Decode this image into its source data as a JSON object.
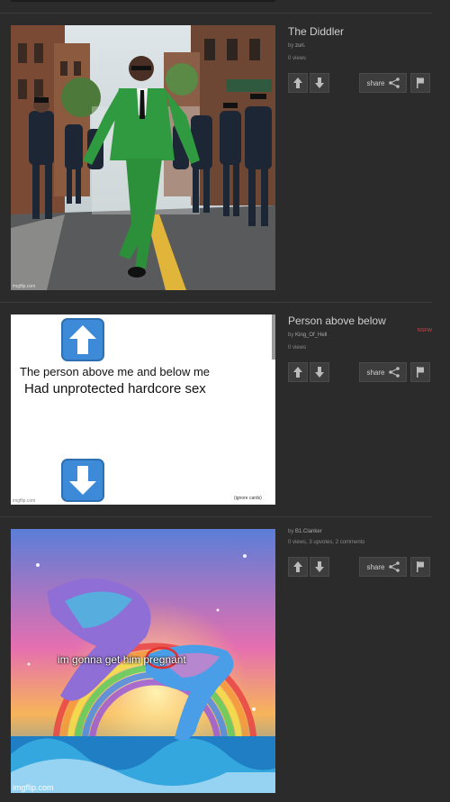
{
  "posts": [
    {
      "title": "The Diddler",
      "by_prefix": "by",
      "author": "zuri.",
      "stats": "0 views",
      "watermark": "imgflip.com"
    },
    {
      "title": "Person above below",
      "by_prefix": "by",
      "author": "King_Of_Hell",
      "stats": "0 views",
      "nsfw": "NSFW",
      "meme_line1": "The person above me and below me",
      "meme_line2": "Had unprotected hardcore sex",
      "footnote": "(ignore cards)",
      "watermark": "imgflip.com"
    },
    {
      "title": "",
      "by_prefix": "by",
      "author": "B1.Clanker",
      "stats": "0 views, 3 upvotes, 2 comments",
      "caption": "im gonna get him pregnant",
      "watermark": "imgflip.com"
    }
  ],
  "controls": {
    "share_label": "share"
  },
  "icons": {
    "upvote": "arrow-up-icon",
    "downvote": "arrow-down-icon",
    "share": "share-icon",
    "flag": "flag-icon"
  },
  "colors": {
    "background": "#2b2b2b",
    "button": "#3d3d3d",
    "nsfw": "#c94a4a"
  }
}
